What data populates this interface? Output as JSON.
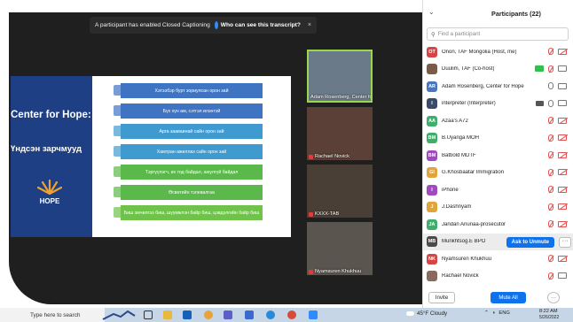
{
  "cc_banner": {
    "message": "A participant has enabled Closed Captioning",
    "link": "Who can see this transcript?",
    "close": "×"
  },
  "slide": {
    "title": "Center for Hope:",
    "subtitle": "Үндсэн зарчмууд",
    "logo_text": "HOPE",
    "steps": [
      {
        "text": "Хэтээбэр бурт зориулсан орон зай",
        "color": "#3f74c2"
      },
      {
        "text": "Бүх хүн ам, сэтгэл илэнтэй",
        "color": "#3f74c2"
      },
      {
        "text": "Арга зааваинай сайн орон зай",
        "color": "#3f9bcf"
      },
      {
        "text": "Хамтран ажиллах сайн орон зай",
        "color": "#3f9bcf"
      },
      {
        "text": "Тэргүүлэгч, их тод байдал, аюулгүй байдал",
        "color": "#5bb84a"
      },
      {
        "text": "Өсвөтийн тэлевалгаа",
        "color": "#5bb84a"
      },
      {
        "text": "Биш эмчилгээ биш, шүүмжлэн байр биш, цэвдэлгийн байр биш",
        "color": "#6fc24a"
      }
    ]
  },
  "videos": [
    {
      "name": "Adam Rosenberg, Center for Ho...",
      "bg": "#6a7a88",
      "muted": false
    },
    {
      "name": "Rachael Novick",
      "bg": "#5a4036",
      "muted": true
    },
    {
      "name": "KXXX-TAB",
      "bg": "#4a3f37",
      "muted": true
    },
    {
      "name": "Nyamsuren Khukhuu",
      "bg": "#5b5550",
      "muted": true
    }
  ],
  "panel": {
    "title": "Participants (22)",
    "search_placeholder": "Find a participant",
    "participants": [
      {
        "initials": "OT",
        "color": "#d64545",
        "name": "Onon, TAF Mongolia (Host, me)",
        "mic": "muted",
        "cam": "off"
      },
      {
        "initials": "",
        "color": "#7a5a48",
        "name": "Duulim, TAF (Co-host)",
        "mic": "muted",
        "cam": "green"
      },
      {
        "initials": "AR",
        "color": "#4a76c0",
        "name": "Adam Rosenberg, Center for Hope",
        "mic": "on",
        "cam": "on"
      },
      {
        "initials": "I",
        "color": "#3a4a6a",
        "name": "interpreter (Interpreter)",
        "mic": "on",
        "cam": "on",
        "interp": true
      },
      {
        "initials": "AA",
        "color": "#3fae6a",
        "name": "Azaa's A72",
        "mic": "muted",
        "cam": "off"
      },
      {
        "initials": "BM",
        "color": "#3fae6a",
        "name": "B.Uyanga MOH",
        "mic": "muted",
        "cam": "off"
      },
      {
        "initials": "BM",
        "color": "#a04ac0",
        "name": "Batbold MDTF",
        "mic": "muted",
        "cam": "off"
      },
      {
        "initials": "GI",
        "color": "#e0a43a",
        "name": "G.Khosbaatar Immigration",
        "mic": "muted",
        "cam": "off"
      },
      {
        "initials": "I",
        "color": "#a04ac0",
        "name": "iPhone",
        "mic": "muted",
        "cam": "off"
      },
      {
        "initials": "J",
        "color": "#e0a43a",
        "name": "J.Dashnyam",
        "mic": "muted",
        "cam": "off"
      },
      {
        "initials": "JA",
        "color": "#3fae6a",
        "name": "Jandan Ariunaa-prosecutor",
        "mic": "muted",
        "cam": "off"
      },
      {
        "initials": "MB",
        "color": "#4a4a4a",
        "name": "Munkhtsog.E BPO",
        "mic": "muted",
        "cam": "off",
        "hover": true
      },
      {
        "initials": "NK",
        "color": "#d64545",
        "name": "Nyamsuren Khukhuu",
        "mic": "muted",
        "cam": "off"
      },
      {
        "initials": "",
        "color": "#8a6a5a",
        "name": "Rachael Novick",
        "mic": "muted",
        "cam": "on"
      }
    ],
    "ask_to_unmute": "Ask to Unmute",
    "more": "···",
    "invite": "Invite",
    "mute_all": "Mute All"
  },
  "taskbar": {
    "search": "Type here to search",
    "weather": "45°F  Cloudy",
    "tray": "ENG",
    "time": "8:22 AM",
    "date": "5/26/2022"
  }
}
